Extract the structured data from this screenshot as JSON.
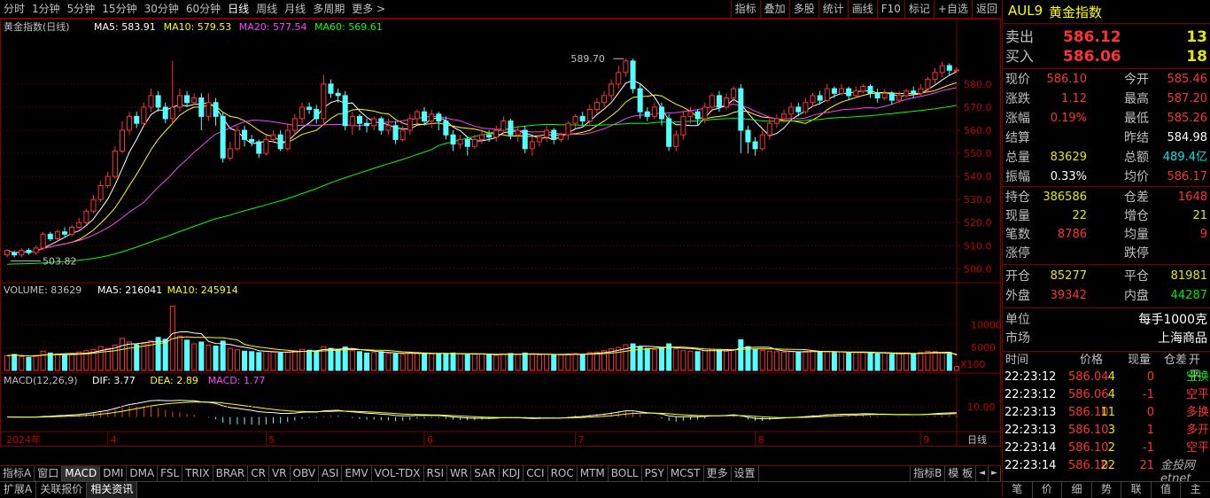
{
  "toolbar": {
    "periods": [
      "分时",
      "1分钟",
      "5分钟",
      "15分钟",
      "30分钟",
      "60分钟",
      "日线",
      "周线",
      "月线",
      "多周期",
      "更多 >"
    ],
    "selected_period": "日线",
    "right_buttons": [
      "指标",
      "叠加",
      "多股",
      "统计",
      "画线",
      "F10",
      "标记",
      "+自选",
      "返回"
    ]
  },
  "chart_data": {
    "type": "candlestick",
    "title": "黄金指数(日线)",
    "ma_labels": [
      {
        "text": "MA5: 583.91",
        "color": "#ffffff"
      },
      {
        "text": "MA10: 579.53",
        "color": "#ffff00"
      },
      {
        "text": "MA20: 577.54",
        "color": "#ff40ff"
      },
      {
        "text": "MA60: 569.61",
        "color": "#00ff00"
      }
    ],
    "price_ylim": [
      494,
      593
    ],
    "price_ticks": [
      "580.0",
      "570.0",
      "560.0",
      "550.0",
      "540.0",
      "530.0",
      "520.0",
      "510.0",
      "500.0"
    ],
    "price_tick_values": [
      580,
      570,
      560,
      550,
      540,
      530,
      520,
      510,
      500
    ],
    "high_label": "589.70",
    "low_label": "503.82",
    "candles": [
      [
        506,
        508,
        505,
        508.5
      ],
      [
        507,
        506,
        505,
        508
      ],
      [
        506,
        508,
        505,
        509
      ],
      [
        508,
        507,
        506,
        509
      ],
      [
        507,
        509,
        506,
        510
      ],
      [
        509,
        515,
        508,
        516
      ],
      [
        515,
        513,
        512,
        516
      ],
      [
        513,
        516,
        512,
        517
      ],
      [
        516,
        515,
        514,
        518
      ],
      [
        515,
        518,
        514,
        519
      ],
      [
        518,
        520,
        517,
        522
      ],
      [
        520,
        525,
        519,
        526
      ],
      [
        525,
        530,
        524,
        532
      ],
      [
        530,
        536,
        529,
        538
      ],
      [
        536,
        540,
        535,
        542
      ],
      [
        540,
        551,
        539,
        553
      ],
      [
        551,
        560,
        550,
        564
      ],
      [
        560,
        566,
        558,
        568
      ],
      [
        566,
        563,
        561,
        568
      ],
      [
        563,
        570,
        562,
        572
      ],
      [
        570,
        575,
        568,
        578
      ],
      [
        575,
        570,
        568,
        577
      ],
      [
        570,
        565,
        563,
        572
      ],
      [
        565,
        570,
        563,
        590
      ],
      [
        570,
        575,
        568,
        578
      ],
      [
        575,
        572,
        570,
        577
      ],
      [
        572,
        574,
        571,
        576
      ],
      [
        574,
        566,
        560,
        576
      ],
      [
        566,
        572,
        564,
        576
      ],
      [
        572,
        566,
        562,
        574
      ],
      [
        566,
        548,
        546,
        568
      ],
      [
        548,
        552,
        547,
        555
      ],
      [
        552,
        560,
        551,
        562
      ],
      [
        560,
        556,
        553,
        562
      ],
      [
        556,
        555,
        553,
        558
      ],
      [
        555,
        550,
        548,
        556
      ],
      [
        550,
        556,
        549,
        558
      ],
      [
        556,
        558,
        555,
        560
      ],
      [
        558,
        552,
        551,
        560
      ],
      [
        552,
        560,
        551,
        563
      ],
      [
        560,
        565,
        558,
        567
      ],
      [
        565,
        570,
        563,
        572
      ],
      [
        570,
        569,
        567,
        572
      ],
      [
        569,
        565,
        563,
        571
      ],
      [
        565,
        580,
        563,
        584
      ],
      [
        580,
        576,
        574,
        582
      ],
      [
        576,
        575,
        572,
        578
      ],
      [
        575,
        562,
        560,
        577
      ],
      [
        562,
        566,
        558,
        568
      ],
      [
        566,
        563,
        560,
        567
      ],
      [
        563,
        562,
        559,
        565
      ],
      [
        562,
        565,
        560,
        566
      ],
      [
        565,
        560,
        558,
        566
      ],
      [
        560,
        562,
        558,
        565
      ],
      [
        562,
        556,
        554,
        564
      ],
      [
        556,
        560,
        555,
        562
      ],
      [
        560,
        565,
        558,
        567
      ],
      [
        565,
        568,
        563,
        569
      ],
      [
        568,
        564,
        562,
        570
      ],
      [
        564,
        567,
        561,
        569
      ],
      [
        567,
        564,
        560,
        568
      ],
      [
        564,
        558,
        556,
        566
      ],
      [
        558,
        554,
        551,
        560
      ],
      [
        554,
        556,
        552,
        558
      ],
      [
        556,
        553,
        549,
        557
      ],
      [
        553,
        556,
        552,
        558
      ],
      [
        556,
        558,
        554,
        560
      ],
      [
        558,
        557,
        555,
        560
      ],
      [
        557,
        560,
        555,
        562
      ],
      [
        560,
        564,
        558,
        566
      ],
      [
        564,
        558,
        556,
        565
      ],
      [
        558,
        560,
        555,
        562
      ],
      [
        560,
        552,
        550,
        562
      ],
      [
        552,
        555,
        549,
        557
      ],
      [
        555,
        557,
        553,
        558
      ],
      [
        557,
        560,
        555,
        562
      ],
      [
        560,
        556,
        554,
        561
      ],
      [
        556,
        558,
        555,
        559
      ],
      [
        558,
        563,
        556,
        564
      ],
      [
        563,
        566,
        561,
        567
      ],
      [
        566,
        564,
        562,
        568
      ],
      [
        564,
        569,
        562,
        571
      ],
      [
        569,
        572,
        567,
        574
      ],
      [
        572,
        575,
        570,
        577
      ],
      [
        575,
        580,
        573,
        582
      ],
      [
        580,
        585,
        578,
        588
      ],
      [
        585,
        590,
        583,
        591
      ],
      [
        590,
        578,
        576,
        591
      ],
      [
        578,
        568,
        565,
        580
      ],
      [
        568,
        566,
        564,
        570
      ],
      [
        566,
        570,
        565,
        572
      ],
      [
        570,
        565,
        562,
        572
      ],
      [
        565,
        553,
        551,
        567
      ],
      [
        553,
        558,
        551,
        560
      ],
      [
        558,
        566,
        556,
        568
      ],
      [
        566,
        568,
        563,
        570
      ],
      [
        568,
        565,
        562,
        569
      ],
      [
        565,
        570,
        563,
        572
      ],
      [
        570,
        575,
        568,
        576
      ],
      [
        575,
        570,
        568,
        577
      ],
      [
        570,
        574,
        569,
        576
      ],
      [
        574,
        578,
        572,
        579
      ],
      [
        578,
        560,
        550,
        580
      ],
      [
        560,
        555,
        550,
        562
      ],
      [
        555,
        552,
        549,
        557
      ],
      [
        552,
        558,
        551,
        560
      ],
      [
        558,
        563,
        556,
        565
      ],
      [
        563,
        565,
        561,
        567
      ],
      [
        565,
        567,
        563,
        569
      ],
      [
        567,
        570,
        565,
        572
      ],
      [
        570,
        568,
        566,
        572
      ],
      [
        568,
        572,
        567,
        574
      ],
      [
        572,
        575,
        570,
        576
      ],
      [
        575,
        573,
        571,
        577
      ],
      [
        573,
        578,
        572,
        580
      ],
      [
        578,
        576,
        574,
        579
      ],
      [
        576,
        578,
        575,
        580
      ],
      [
        578,
        575,
        573,
        579
      ],
      [
        575,
        577,
        574,
        579
      ],
      [
        577,
        579,
        576,
        580
      ],
      [
        579,
        576,
        574,
        580
      ],
      [
        576,
        574,
        572,
        578
      ],
      [
        574,
        576,
        573,
        578
      ],
      [
        576,
        573,
        571,
        577
      ],
      [
        573,
        575,
        572,
        577
      ],
      [
        575,
        577,
        574,
        578
      ],
      [
        577,
        576,
        574,
        579
      ],
      [
        576,
        578,
        575,
        580
      ],
      [
        578,
        582,
        577,
        583
      ],
      [
        582,
        585,
        580,
        587
      ],
      [
        585,
        588,
        583,
        589.7
      ],
      [
        588,
        586,
        584,
        589
      ],
      [
        586,
        586.1,
        585.3,
        587.2
      ]
    ],
    "volume_title": "VOLUME: 83629",
    "volume_labels": [
      {
        "text": "MA5: 216041",
        "color": "#ffffff"
      },
      {
        "text": "MA10: 245914",
        "color": "#ffff00"
      }
    ],
    "volume_ticks": [
      "10000",
      "5000"
    ],
    "volume_tick_values": [
      10000,
      5000
    ],
    "volume_unit": "X100",
    "volume_ylim": [
      0,
      14500
    ],
    "volumes": [
      3200,
      3500,
      3000,
      2800,
      3300,
      4200,
      3800,
      3600,
      3400,
      3500,
      4000,
      4300,
      4600,
      5200,
      4800,
      5500,
      7000,
      6200,
      5600,
      5800,
      6500,
      7200,
      6800,
      14000,
      7500,
      6600,
      5800,
      6200,
      5500,
      5300,
      6400,
      4800,
      4500,
      4200,
      4100,
      3900,
      4200,
      4000,
      3800,
      4000,
      4300,
      4600,
      4400,
      4200,
      5200,
      4800,
      4500,
      5100,
      4300,
      4100,
      3800,
      3900,
      4100,
      3700,
      3600,
      3500,
      3800,
      3900,
      3700,
      3600,
      3500,
      3700,
      3800,
      3600,
      3400,
      3500,
      3600,
      3400,
      3300,
      3600,
      3700,
      3500,
      3800,
      3500,
      3400,
      3500,
      3300,
      3400,
      3600,
      3700,
      3500,
      3900,
      4000,
      4300,
      4700,
      5000,
      5600,
      5800,
      5200,
      4800,
      4500,
      4900,
      5800,
      4700,
      4300,
      4200,
      4100,
      4300,
      4600,
      4400,
      4200,
      4500,
      6700,
      5200,
      4600,
      4400,
      4200,
      4100,
      4000,
      4100,
      3900,
      4200,
      4300,
      4000,
      4100,
      3900,
      4000,
      3800,
      3900,
      4000,
      3700,
      3600,
      3800,
      3500,
      3700,
      3800,
      3600,
      3900,
      4200,
      4100,
      3800,
      3900,
      837
    ],
    "macd_title": "MACD(12,26,9)",
    "macd_labels": [
      {
        "text": "DIF: 3.77",
        "color": "#ffffff"
      },
      {
        "text": "DEA: 2.89",
        "color": "#ffff00"
      },
      {
        "text": "MACD: 1.77",
        "color": "#ff40ff"
      }
    ],
    "macd_tick": "10.00",
    "macd_tick_value": 10,
    "macd_ylim": [
      -14,
      27
    ],
    "x_labels": [
      {
        "text": "2024年",
        "index": 0
      },
      {
        "text": "4",
        "index": 14
      },
      {
        "text": "5",
        "index": 36
      },
      {
        "text": "6",
        "index": 58
      },
      {
        "text": "7",
        "index": 79
      },
      {
        "text": "8",
        "index": 104
      },
      {
        "text": "9",
        "index": 127
      }
    ],
    "period_label": "日线"
  },
  "indicators": [
    "指标A",
    "窗口",
    "MACD",
    "DMI",
    "DMA",
    "FSL",
    "TRIX",
    "BRAR",
    "CR",
    "VR",
    "OBV",
    "ASI",
    "EMV",
    "VOL-TDX",
    "RSI",
    "WR",
    "SAR",
    "KDJ",
    "CCI",
    "ROC",
    "MTM",
    "BOLL",
    "PSY",
    "MCST",
    "更多",
    "设置"
  ],
  "indicators_right": [
    "指标B",
    "模 板"
  ],
  "bottom_tabs": [
    "扩展A",
    "关联报价",
    "相关资讯"
  ],
  "panel": {
    "symbol": "AUL9",
    "name": "黄金指数",
    "sell_label": "卖出",
    "sell_price": "586.12",
    "sell_vol": "13",
    "buy_label": "买入",
    "buy_price": "586.06",
    "buy_vol": "18",
    "quote_rows": [
      {
        "k1": "现价",
        "v1": "586.10",
        "c1": "red",
        "k2": "今开",
        "v2": "585.46",
        "c2": "red"
      },
      {
        "k1": "涨跌",
        "v1": "1.12",
        "c1": "red",
        "k2": "最高",
        "v2": "587.20",
        "c2": "red"
      },
      {
        "k1": "涨幅",
        "v1": "0.19%",
        "c1": "red",
        "k2": "最低",
        "v2": "585.26",
        "c2": "red"
      },
      {
        "k1": "结算",
        "v1": "",
        "c1": "wht",
        "k2": "昨结",
        "v2": "584.98",
        "c2": "wht"
      },
      {
        "k1": "总量",
        "v1": "83629",
        "c1": "yel",
        "k2": "总额",
        "v2": "489.4亿",
        "c2": "cyn"
      },
      {
        "k1": "振幅",
        "v1": "0.33%",
        "c1": "wht",
        "k2": "均价",
        "v2": "586.17",
        "c2": "red"
      }
    ],
    "pos_rows": [
      {
        "k1": "持仓",
        "v1": "386586",
        "c1": "yel",
        "k2": "仓差",
        "v2": "1648",
        "c2": "red"
      },
      {
        "k1": "现量",
        "v1": "22",
        "c1": "yel",
        "k2": "增仓",
        "v2": "21",
        "c2": "yel"
      },
      {
        "k1": "笔数",
        "v1": "8786",
        "c1": "red",
        "k2": "均量",
        "v2": "9",
        "c2": "red"
      },
      {
        "k1": "涨停",
        "v1": "",
        "c1": "wht",
        "k2": "跌停",
        "v2": "",
        "c2": "wht"
      }
    ],
    "trade_rows": [
      {
        "k1": "开仓",
        "v1": "85277",
        "c1": "yel",
        "k2": "平仓",
        "v2": "81981",
        "c2": "yel"
      },
      {
        "k1": "外盘",
        "v1": "39342",
        "c1": "red",
        "k2": "内盘",
        "v2": "44287",
        "c2": "grn"
      }
    ],
    "unit_label": "单位",
    "unit_value": "每手1000克",
    "market_label": "市场",
    "market_value": "上海商品",
    "tick_headers": [
      "时间",
      "价格",
      "现量",
      "仓差",
      "开平"
    ],
    "ticks": [
      {
        "time": "22:23:12",
        "price": "586.04",
        "vol": "4",
        "diff": "0",
        "type": "空换",
        "tc": "grn"
      },
      {
        "time": "22:23:12",
        "price": "586.06",
        "vol": "4",
        "diff": "-1",
        "type": "空平",
        "tc": "red"
      },
      {
        "time": "22:23:13",
        "price": "586.10",
        "vol": "11",
        "diff": "0",
        "type": "多换",
        "tc": "red"
      },
      {
        "time": "22:23:13",
        "price": "586.10",
        "vol": "3",
        "diff": "1",
        "type": "多开",
        "tc": "red"
      },
      {
        "time": "22:23:14",
        "price": "586.10",
        "vol": "2",
        "diff": "-1",
        "type": "空平",
        "tc": "red"
      },
      {
        "time": "22:23:14",
        "price": "586.10",
        "vol": "22",
        "diff": "21",
        "type": "",
        "tc": "red"
      }
    ],
    "panel_tabs": [
      "笔",
      "价",
      "细",
      "势",
      "联",
      "值",
      "主"
    ],
    "watermark": "金投网 etnet"
  }
}
